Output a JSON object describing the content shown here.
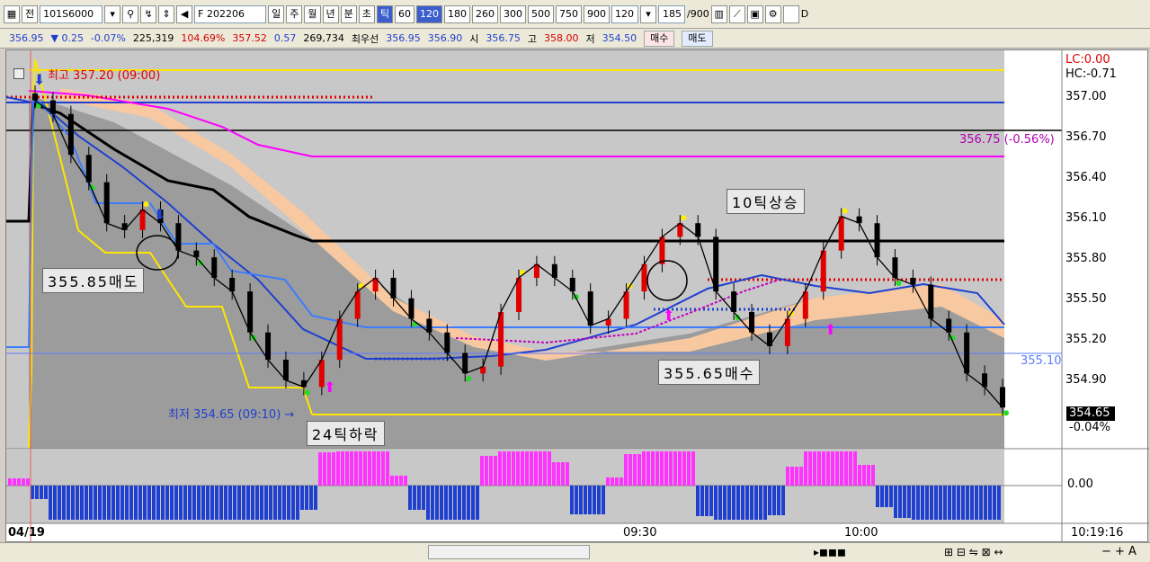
{
  "toolbar": {
    "mode_btn": "전",
    "code_value": "101S6000",
    "contract_value": "F 202206",
    "period_tabs": [
      "일",
      "주",
      "월",
      "년",
      "분",
      "초",
      "틱"
    ],
    "selected_period": "틱",
    "tick_presets": [
      "60",
      "120",
      "180",
      "260",
      "300",
      "500",
      "750",
      "900"
    ],
    "selected_tick": "120",
    "tick_select": "120",
    "count_value": "185",
    "count_max": "/900",
    "d_checkbox": "D"
  },
  "quote": {
    "last": "356.95",
    "change": "▼ 0.25",
    "change_pct": "-0.07%",
    "volume": "225,319",
    "vol_ratio": "104.69%",
    "theory": "357.52",
    "basis": "0.57",
    "open_int": "269,734",
    "best_label": "최우선",
    "ask": "356.95",
    "bid": "356.90",
    "open_label": "시",
    "open": "356.75",
    "high_label": "고",
    "high": "358.00",
    "low_label": "저",
    "low": "354.50",
    "buy_btn": "매수",
    "sell_btn": "매도"
  },
  "chart": {
    "header_left": "최고 357.20 (09:00)",
    "low_marker": "최저 354.65 (09:10) →",
    "lc": "LC:0.00",
    "hc": "HC:-0.71",
    "magenta_label": "356.75 (-0.56%)",
    "magenta_label2": "356.75",
    "blue_level": "355.10",
    "last_price": "354.65",
    "last_pct": "-0.04%",
    "annotations": {
      "sell": "355.85매도",
      "buy": "355.65매수",
      "up": "10틱상승",
      "down": "24틱하락"
    },
    "y_ticks": [
      "357.00",
      "356.70",
      "356.40",
      "356.10",
      "355.80",
      "355.50",
      "355.20",
      "354.90"
    ],
    "osc_tick": "0.00",
    "x_labels": [
      "04/19",
      "09:30",
      "10:00",
      "10:19:16"
    ]
  },
  "chart_data": {
    "type": "candlestick",
    "ylim": [
      354.5,
      357.2
    ],
    "high_marker": 357.2,
    "low_marker": 354.65,
    "last": 354.65,
    "levels": {
      "yellow_top": 357.2,
      "yellow_bottom": 354.65,
      "blue_top": 357.05,
      "black_mid": 356.75,
      "magenta": 356.55,
      "red_dots": 355.65
    },
    "close_series": [
      356.9,
      356.8,
      356.5,
      356.3,
      356.0,
      355.95,
      356.1,
      356.0,
      355.8,
      355.75,
      355.6,
      355.5,
      355.2,
      355.0,
      354.85,
      354.8,
      355.0,
      355.3,
      355.5,
      355.6,
      355.45,
      355.3,
      355.2,
      355.05,
      354.9,
      354.95,
      355.35,
      355.6,
      355.7,
      355.6,
      355.5,
      355.25,
      355.3,
      355.5,
      355.7,
      355.9,
      356.0,
      355.9,
      355.5,
      355.35,
      355.2,
      355.1,
      355.3,
      355.5,
      355.8,
      356.05,
      356.0,
      355.75,
      355.6,
      355.55,
      355.3,
      355.2,
      354.9,
      354.8,
      354.65
    ]
  }
}
